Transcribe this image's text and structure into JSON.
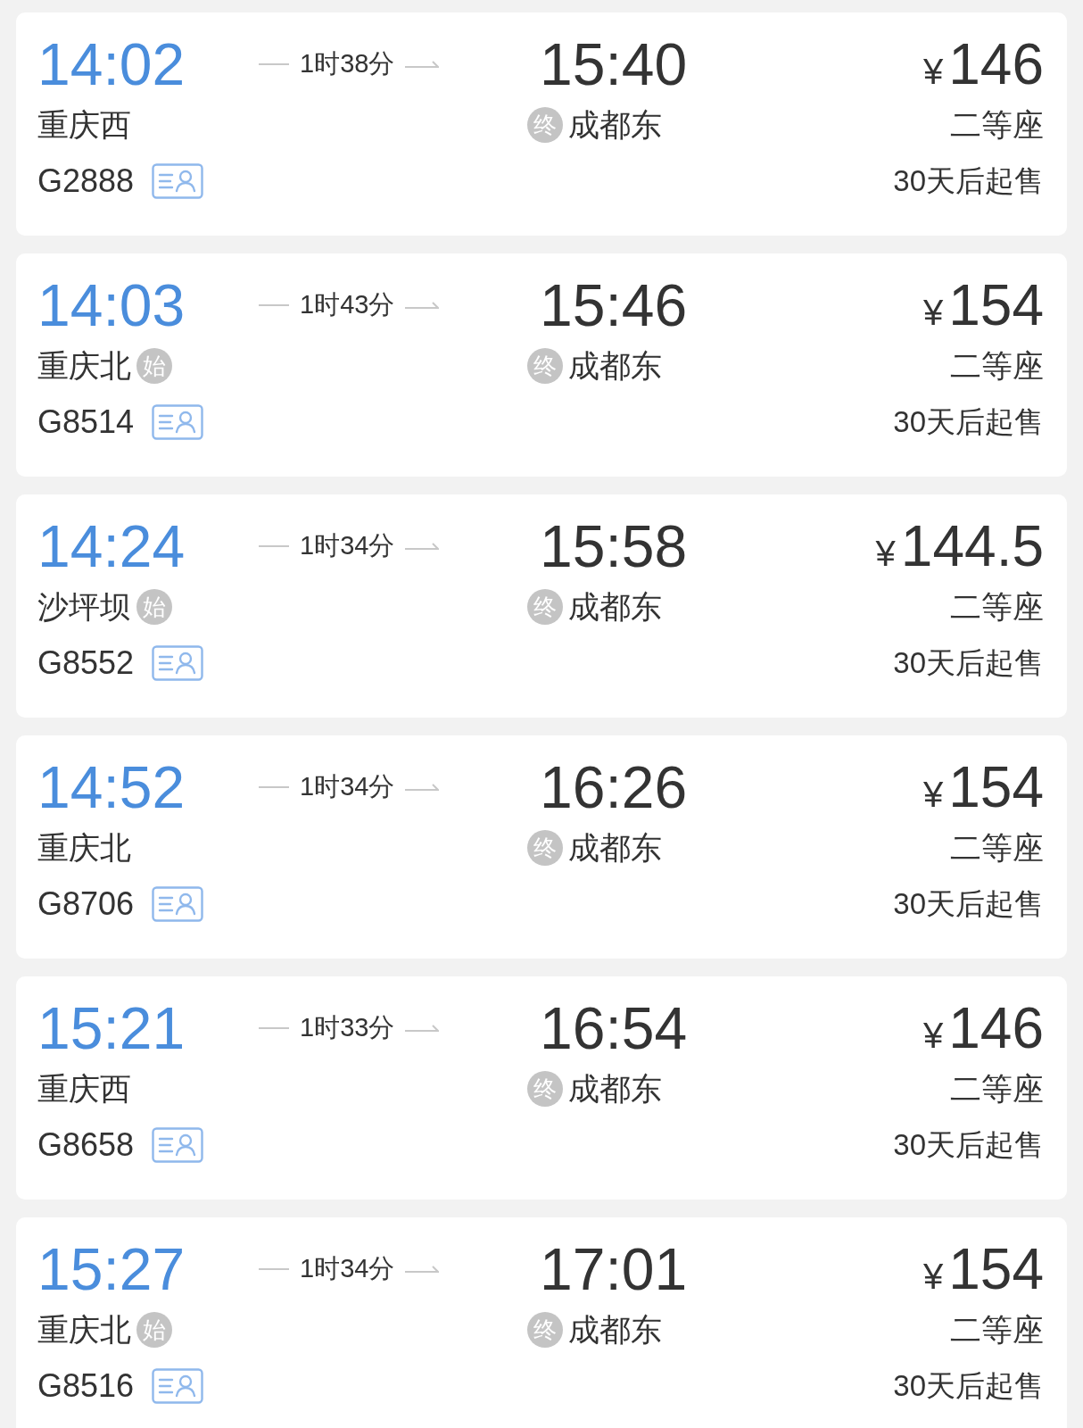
{
  "trains": [
    {
      "depart_time": "14:02",
      "duration": "1时38分",
      "arrive_time": "15:40",
      "from_station": "重庆西",
      "to_badge": "终",
      "to_station": "成都东",
      "train_no": "G2888",
      "currency": "¥",
      "price": "146",
      "seat": "二等座",
      "sale_note": "30天后起售"
    },
    {
      "depart_time": "14:03",
      "duration": "1时43分",
      "arrive_time": "15:46",
      "from_station": "重庆北",
      "from_badge": "始",
      "to_badge": "终",
      "to_station": "成都东",
      "train_no": "G8514",
      "currency": "¥",
      "price": "154",
      "seat": "二等座",
      "sale_note": "30天后起售"
    },
    {
      "depart_time": "14:24",
      "duration": "1时34分",
      "arrive_time": "15:58",
      "from_station": "沙坪坝",
      "from_badge": "始",
      "to_badge": "终",
      "to_station": "成都东",
      "train_no": "G8552",
      "currency": "¥",
      "price": "144.5",
      "seat": "二等座",
      "sale_note": "30天后起售"
    },
    {
      "depart_time": "14:52",
      "duration": "1时34分",
      "arrive_time": "16:26",
      "from_station": "重庆北",
      "to_badge": "终",
      "to_station": "成都东",
      "train_no": "G8706",
      "currency": "¥",
      "price": "154",
      "seat": "二等座",
      "sale_note": "30天后起售"
    },
    {
      "depart_time": "15:21",
      "duration": "1时33分",
      "arrive_time": "16:54",
      "from_station": "重庆西",
      "to_badge": "终",
      "to_station": "成都东",
      "train_no": "G8658",
      "currency": "¥",
      "price": "146",
      "seat": "二等座",
      "sale_note": "30天后起售"
    },
    {
      "depart_time": "15:27",
      "duration": "1时34分",
      "arrive_time": "17:01",
      "from_station": "重庆北",
      "from_badge": "始",
      "to_badge": "终",
      "to_station": "成都东",
      "train_no": "G8516",
      "currency": "¥",
      "price": "154",
      "seat": "二等座",
      "sale_note": "30天后起售"
    }
  ]
}
